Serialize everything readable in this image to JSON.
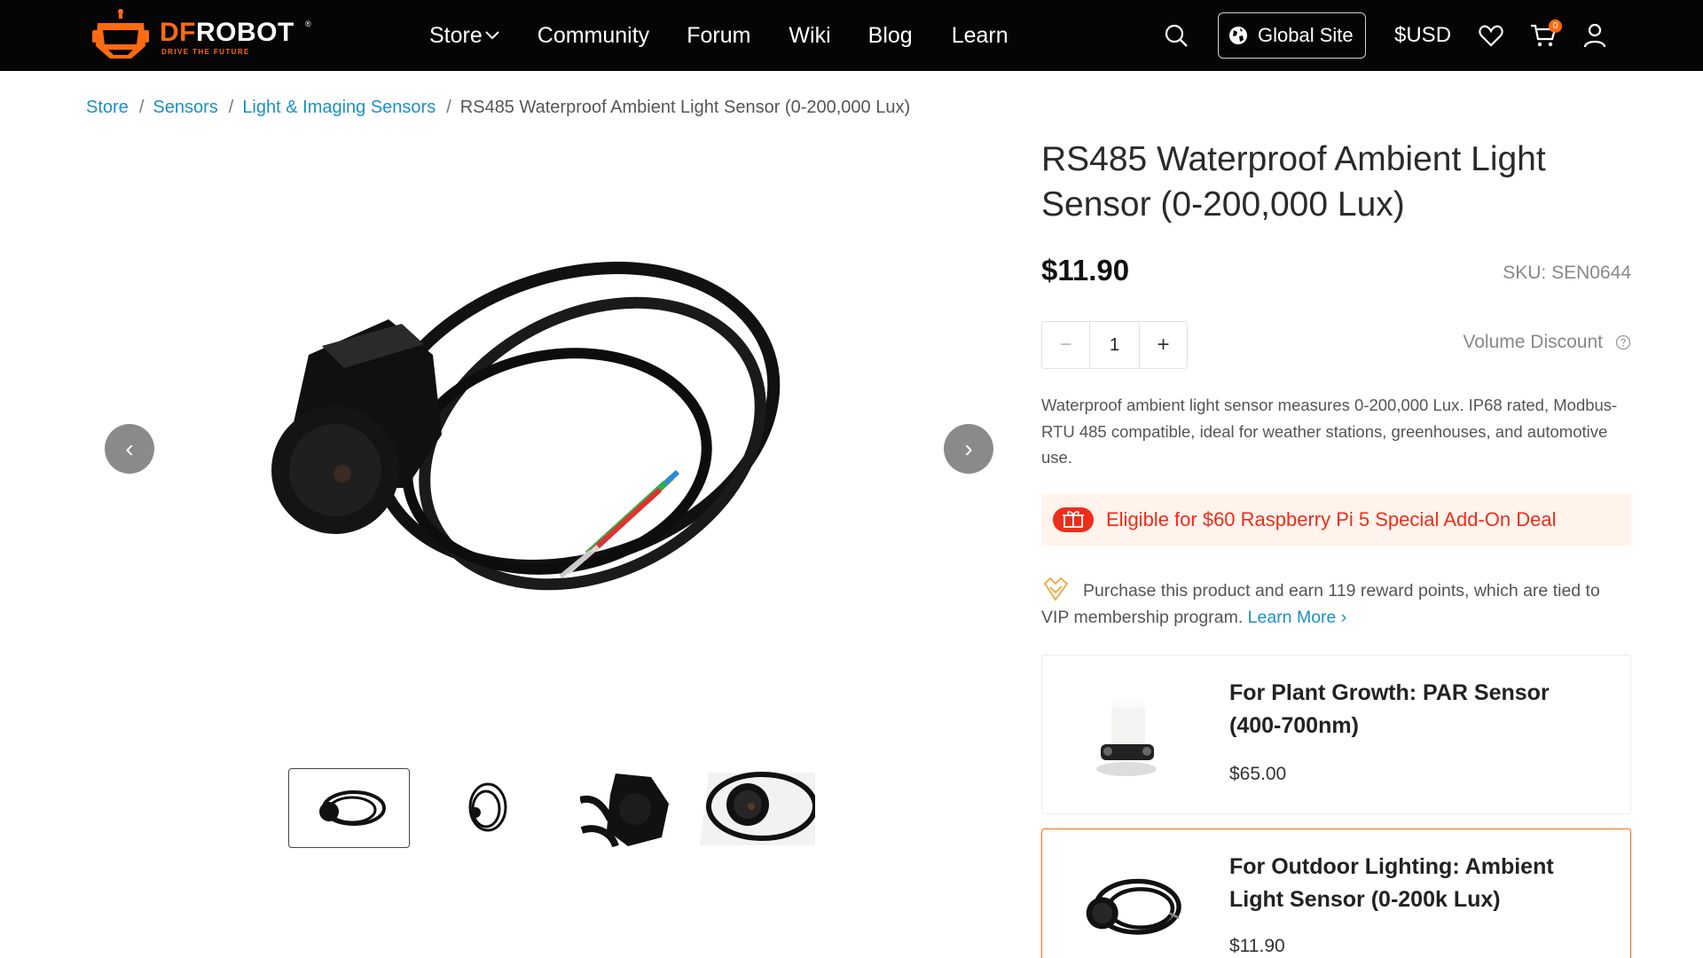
{
  "brand": {
    "name_accent": "DF",
    "name_rest": "ROBOT",
    "registered": "®",
    "tagline": "DRIVE THE FUTURE",
    "accent_color": "#ff6b11"
  },
  "nav": {
    "items": [
      {
        "label": "Store",
        "has_dropdown": true
      },
      {
        "label": "Community"
      },
      {
        "label": "Forum"
      },
      {
        "label": "Wiki"
      },
      {
        "label": "Blog"
      },
      {
        "label": "Learn"
      }
    ],
    "global_site_label": "Global Site",
    "currency_label": "$USD",
    "cart_count": "0",
    "icons": [
      "search-icon",
      "globe-icon",
      "heart-icon",
      "cart-icon",
      "user-icon"
    ]
  },
  "breadcrumb": {
    "links": [
      "Store",
      "Sensors",
      "Light & Imaging Sensors"
    ],
    "separator": "/",
    "current": "RS485 Waterproof Ambient Light Sensor (0-200,000 Lux)"
  },
  "product": {
    "title": "RS485 Waterproof Ambient Light Sensor (0-200,000 Lux)",
    "price": "$11.90",
    "sku": "SKU: SEN0644",
    "quantity": "1",
    "minus_label": "−",
    "plus_label": "+",
    "volume_discount_label": "Volume Discount",
    "description": "Waterproof ambient light sensor measures 0-200,000 Lux. IP68 rated, Modbus-RTU 485 compatible, ideal for weather stations, greenhouses, and automotive use.",
    "deal_text": "Eligible for $60 Raspberry Pi 5 Special Add-On Deal",
    "reward_text": "Purchase this product and earn 119 reward points, which are tied to VIP membership program.",
    "learn_more_label": "Learn More ›"
  },
  "gallery": {
    "prev_label": "‹",
    "next_label": "›",
    "thumbnail_count": 4,
    "active_thumbnail": 1
  },
  "related": [
    {
      "title": "For Plant Growth: PAR Sensor (400-700nm)",
      "price": "$65.00"
    },
    {
      "title": "For Outdoor Lighting: Ambient Light Sensor (0-200k Lux)",
      "price": "$11.90"
    }
  ],
  "colors": {
    "topbar_bg": "#050505",
    "link": "#1d8fc4",
    "deal_bg": "#fff3ec",
    "deal_text": "#ec2e1b"
  }
}
